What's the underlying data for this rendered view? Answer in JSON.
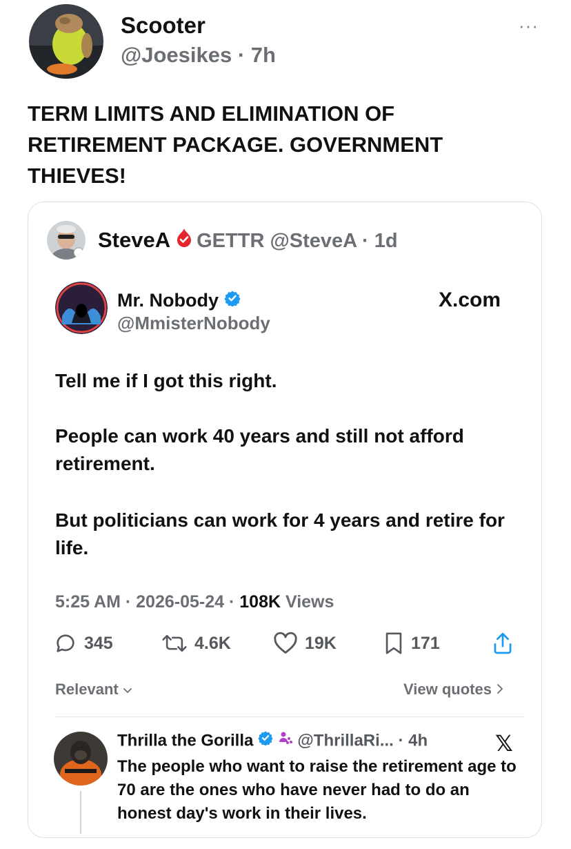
{
  "post": {
    "author_name": "Scooter",
    "author_handle": "@Joesikes",
    "age": "7h",
    "more_label": "···",
    "body": "TERM LIMITS AND ELIMINATION OF RETIREMENT PACKAGE. GOVERNMENT THIEVES!"
  },
  "quote": {
    "author_name": "SteveA",
    "platform": "GETTR",
    "author_handle": "@SteveA",
    "age": "1d",
    "screenshot": {
      "author_name": "Mr. Nobody",
      "author_handle": "@MmisterNobody",
      "source": "X.com",
      "paragraphs": [
        "Tell me if I got this right.",
        "People can work 40 years and still not afford retirement.",
        "But politicians can work for 4 years and retire for life."
      ],
      "time": "5:25 AM",
      "date": "2026-05-24",
      "views_count": "108K",
      "views_label": "Views",
      "actions": {
        "replies": "345",
        "reposts": "4.6K",
        "likes": "19K",
        "bookmarks": "171"
      },
      "sort_label": "Relevant",
      "view_quotes_label": "View quotes",
      "reply": {
        "author_name": "Thrilla the Gorilla",
        "author_handle": "@ThrillaRi...",
        "age": "4h",
        "x_logo": "𝕏",
        "text": "The people who want to raise the retirement age to 70 are the ones who have never had to do an honest day's work in their lives."
      }
    }
  },
  "colors": {
    "verified_blue": "#1d9bf0",
    "gettr_red": "#e5262d",
    "affiliate_purple": "#b040c8",
    "muted_text": "#6b6f74"
  }
}
